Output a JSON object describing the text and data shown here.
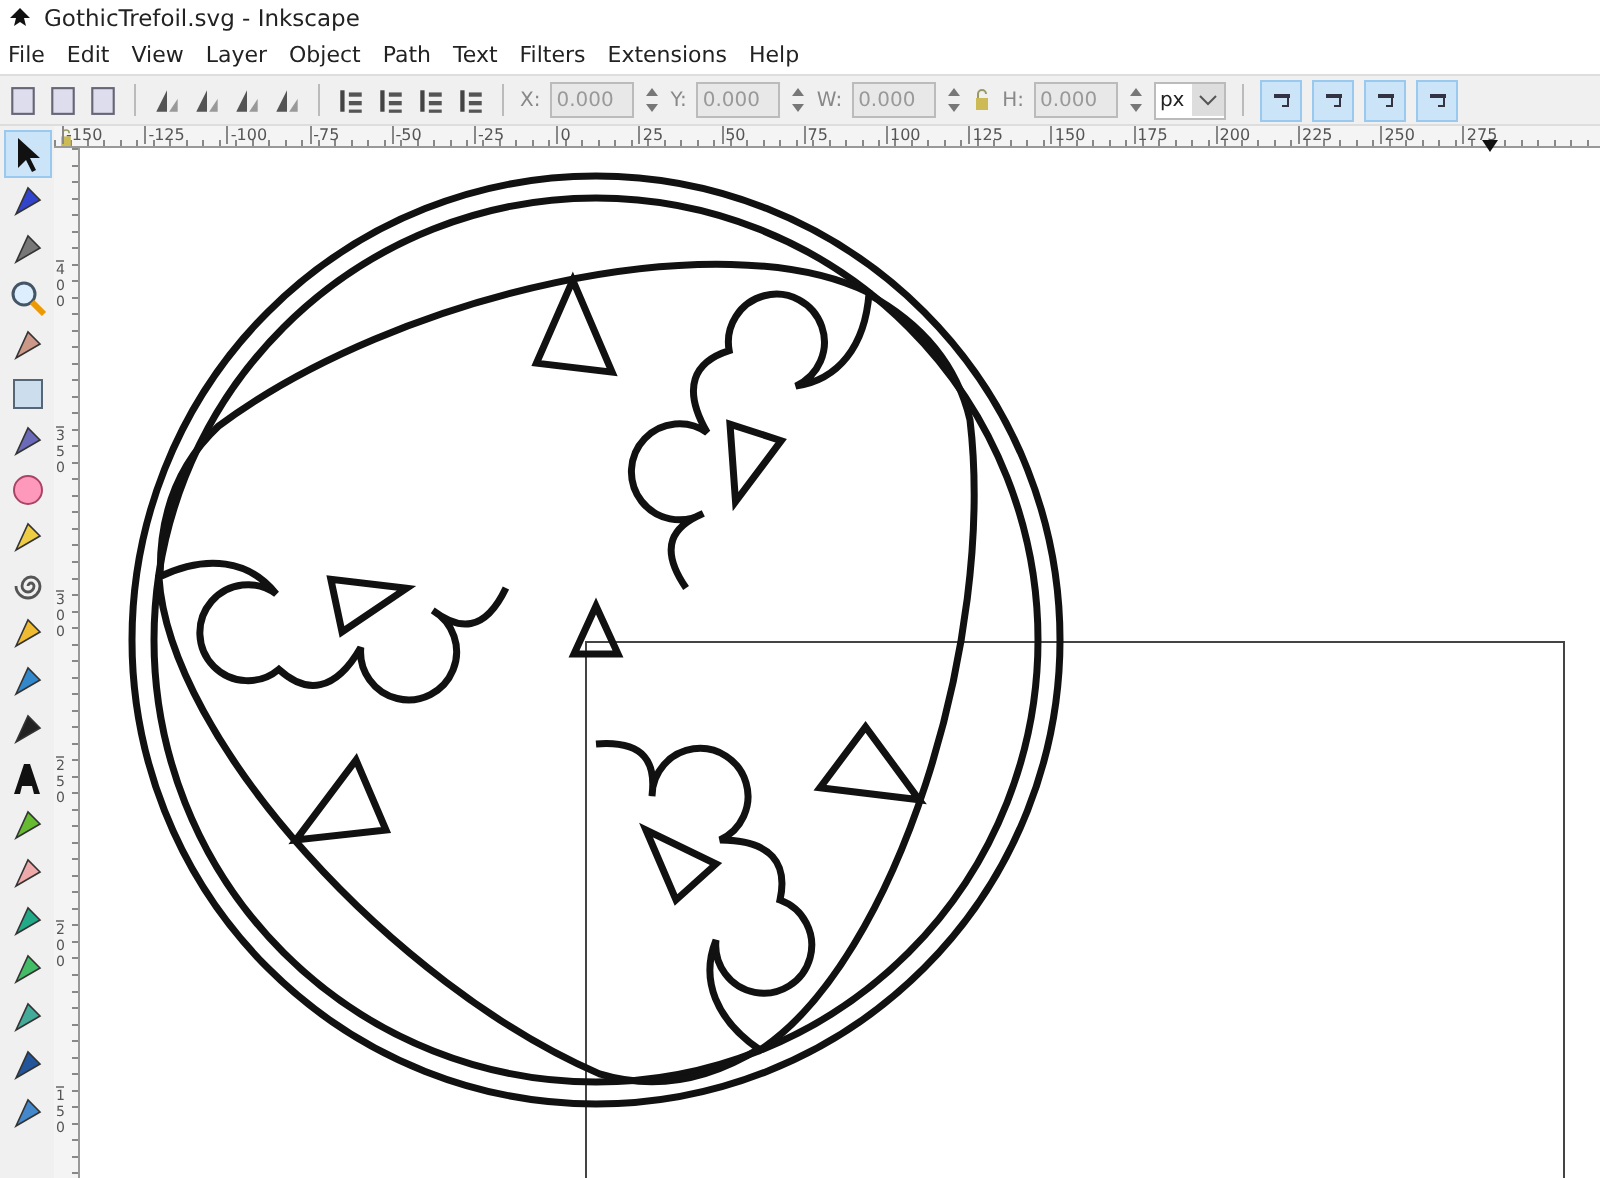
{
  "window": {
    "title": "GothicTrefoil.svg - Inkscape"
  },
  "menu": [
    "File",
    "Edit",
    "View",
    "Layer",
    "Object",
    "Path",
    "Text",
    "Filters",
    "Extensions",
    "Help"
  ],
  "toolbar": {
    "fields": [
      {
        "label": "X:",
        "value": "0.000"
      },
      {
        "label": "Y:",
        "value": "0.000"
      },
      {
        "label": "W:",
        "value": "0.000"
      },
      {
        "label": "H:",
        "value": "0.000"
      }
    ],
    "unit": "px",
    "scale_toggles": [
      {
        "on": true
      },
      {
        "on": true
      },
      {
        "on": true
      },
      {
        "on": true
      }
    ]
  },
  "tools": [
    {
      "kind": "selector",
      "selected": true
    },
    {
      "kind": "node",
      "selected": false
    },
    {
      "kind": "tweak",
      "selected": false
    },
    {
      "kind": "zoom",
      "selected": false
    },
    {
      "kind": "measure",
      "selected": false
    },
    {
      "kind": "rect",
      "selected": false
    },
    {
      "kind": "box",
      "selected": false
    },
    {
      "kind": "ellipse",
      "selected": false
    },
    {
      "kind": "star",
      "selected": false
    },
    {
      "kind": "spiral",
      "selected": false
    },
    {
      "kind": "pencil",
      "selected": false
    },
    {
      "kind": "pen",
      "selected": false
    },
    {
      "kind": "calligraphy",
      "selected": false
    },
    {
      "kind": "text",
      "selected": false
    },
    {
      "kind": "spray",
      "selected": false
    },
    {
      "kind": "eraser",
      "selected": false
    },
    {
      "kind": "bucket",
      "selected": false
    },
    {
      "kind": "gradient",
      "selected": false
    },
    {
      "kind": "mesh",
      "selected": false
    },
    {
      "kind": "dropper",
      "selected": false
    },
    {
      "kind": "connector",
      "selected": false
    }
  ],
  "rulers": {
    "horizontal": [
      "-150",
      "-125",
      "-100",
      "-75",
      "-50",
      "-25",
      "0",
      "25",
      "50",
      "75",
      "100",
      "125",
      "150",
      "175",
      "200",
      "225",
      "250",
      "275"
    ],
    "vertical": [
      "400",
      "350",
      "300",
      "250",
      "200",
      "150"
    ]
  }
}
